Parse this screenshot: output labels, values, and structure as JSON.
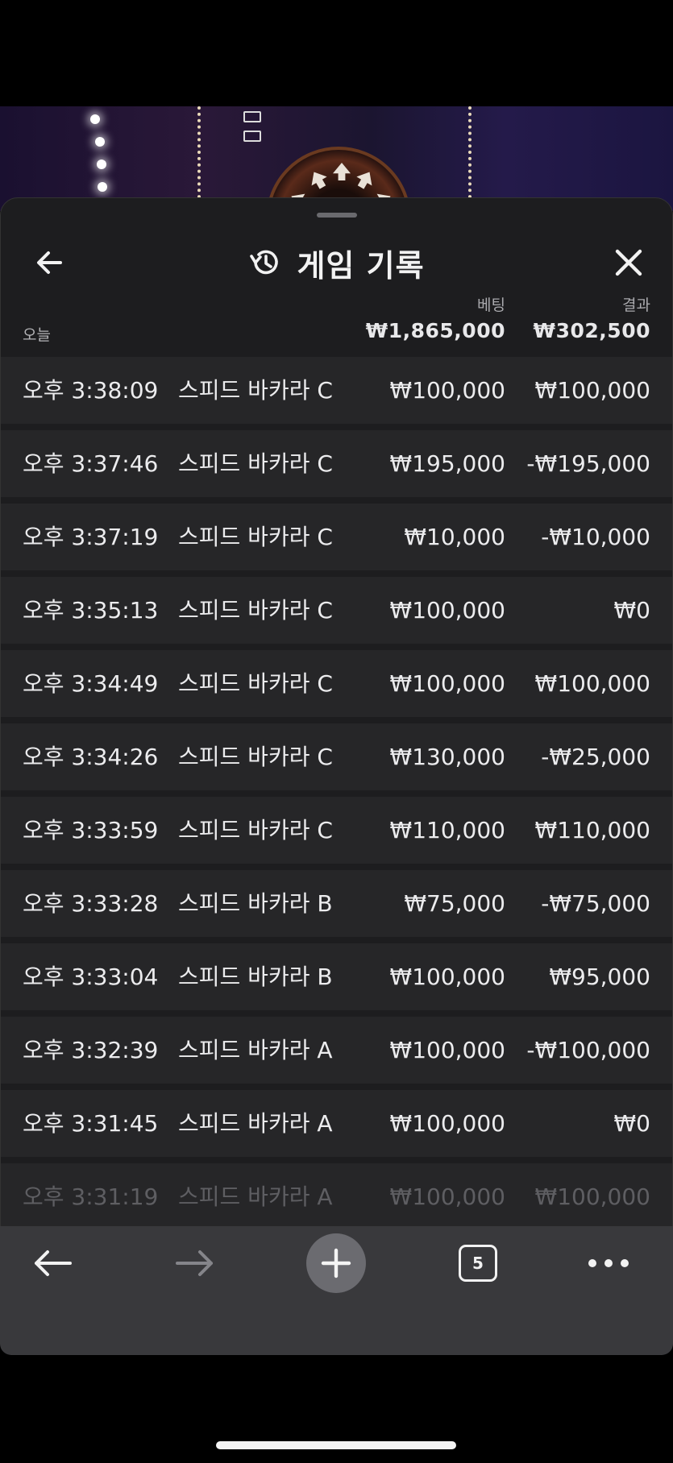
{
  "header": {
    "title": "게임 기록",
    "back_icon": "arrow-left-icon",
    "history_icon": "history-icon",
    "close_icon": "close-icon"
  },
  "summary": {
    "period_label": "오늘",
    "bet_label": "베팅",
    "result_label": "결과",
    "bet_total": "₩1,865,000",
    "result_total": "₩302,500"
  },
  "rows": [
    {
      "time": "오후 3:38:09",
      "game": "스피드 바카라 C",
      "bet": "₩100,000",
      "result": "₩100,000"
    },
    {
      "time": "오후 3:37:46",
      "game": "스피드 바카라 C",
      "bet": "₩195,000",
      "result": "-₩195,000"
    },
    {
      "time": "오후 3:37:19",
      "game": "스피드 바카라 C",
      "bet": "₩10,000",
      "result": "-₩10,000"
    },
    {
      "time": "오후 3:35:13",
      "game": "스피드 바카라 C",
      "bet": "₩100,000",
      "result": "₩0"
    },
    {
      "time": "오후 3:34:49",
      "game": "스피드 바카라 C",
      "bet": "₩100,000",
      "result": "₩100,000"
    },
    {
      "time": "오후 3:34:26",
      "game": "스피드 바카라 C",
      "bet": "₩130,000",
      "result": "-₩25,000"
    },
    {
      "time": "오후 3:33:59",
      "game": "스피드 바카라 C",
      "bet": "₩110,000",
      "result": "₩110,000"
    },
    {
      "time": "오후 3:33:28",
      "game": "스피드 바카라 B",
      "bet": "₩75,000",
      "result": "-₩75,000"
    },
    {
      "time": "오후 3:33:04",
      "game": "스피드 바카라 B",
      "bet": "₩100,000",
      "result": "₩95,000"
    },
    {
      "time": "오후 3:32:39",
      "game": "스피드 바카라 A",
      "bet": "₩100,000",
      "result": "-₩100,000"
    },
    {
      "time": "오후 3:31:45",
      "game": "스피드 바카라 A",
      "bet": "₩100,000",
      "result": "₩0"
    },
    {
      "time": "오후 3:31:19",
      "game": "스피드 바카라 A",
      "bet": "₩100,000",
      "result": "₩100,000"
    }
  ],
  "toolbar": {
    "back_icon": "arrow-left-icon",
    "forward_icon": "arrow-right-icon",
    "new_tab_icon": "plus-icon",
    "tab_count": "5",
    "more_icon": "more-horizontal-icon"
  },
  "colors": {
    "sheet_bg": "#1d1d1f",
    "row_bg": "#262628",
    "toolbar_bg": "#39393c",
    "text": "#ececee",
    "muted": "#a9a9ad"
  }
}
